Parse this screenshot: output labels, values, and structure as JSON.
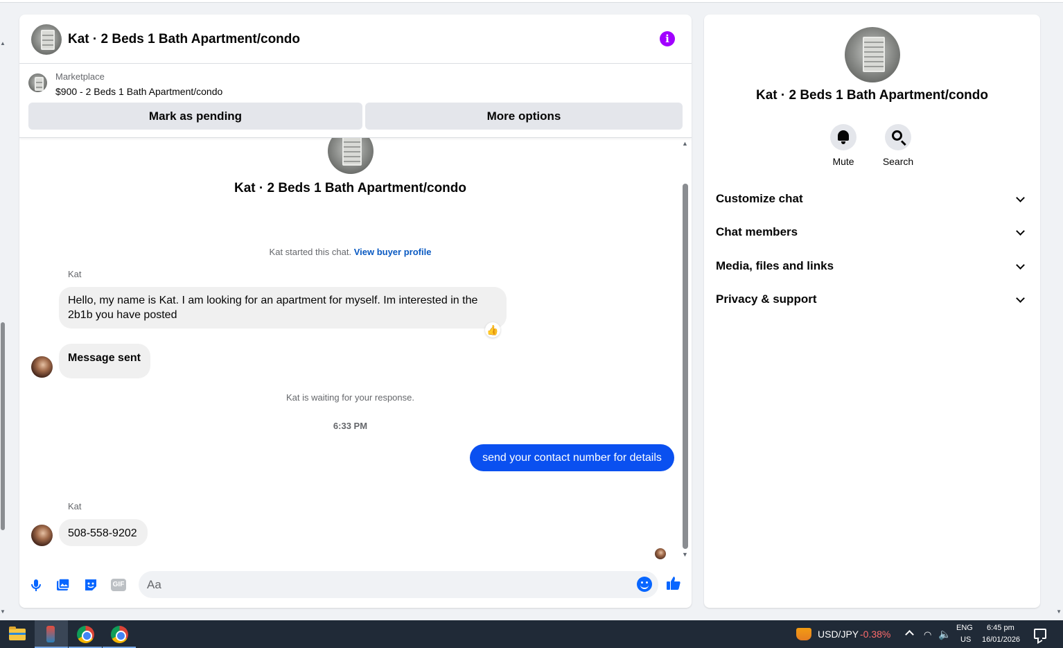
{
  "header": {
    "title": "Kat · 2 Beds 1 Bath Apartment/condo",
    "info_icon": "i"
  },
  "marketplace": {
    "label": "Marketplace",
    "listing": "$900 - 2 Beds 1 Bath Apartment/condo",
    "mark_pending": "Mark as pending",
    "more_options": "More options"
  },
  "conversation": {
    "intro_title": "Kat · 2 Beds 1 Bath Apartment/condo",
    "started_text": "Kat started this chat.",
    "buyer_profile_link": "View buyer profile",
    "waiting_text": "Kat is waiting for your response.",
    "timestamp": "6:33 PM",
    "messages": [
      {
        "sender": "Kat",
        "text": "Hello, my name is Kat. I am looking for an apartment for myself. Im interested in the 2b1b you have posted",
        "reaction": "👍"
      },
      {
        "sender": "",
        "text": "Message sent"
      },
      {
        "sender": "me",
        "text": "send your contact number for details"
      },
      {
        "sender": "Kat",
        "text": "508-558-9202"
      }
    ]
  },
  "composer": {
    "placeholder": "Aa",
    "gif_label": "GIF"
  },
  "info_panel": {
    "title": "Kat · 2 Beds 1 Bath Apartment/condo",
    "actions": [
      {
        "label": "Mute",
        "icon": "bell-icon"
      },
      {
        "label": "Search",
        "icon": "search-icon"
      }
    ],
    "sections": [
      "Customize chat",
      "Chat members",
      "Media, files and links",
      "Privacy & support"
    ]
  },
  "taskbar": {
    "stock_symbol": "USD/JPY",
    "stock_change": "-0.38%",
    "lang_line1": "ENG",
    "lang_line2": "US",
    "time": "6:45 pm",
    "date": "16/01/2026"
  },
  "colors": {
    "accent": "#0866ff",
    "outgoing_bubble": "#0a50f0",
    "info_icon": "#a100ff",
    "link": "#0a5ac2",
    "negative": "#ff6b6b"
  }
}
